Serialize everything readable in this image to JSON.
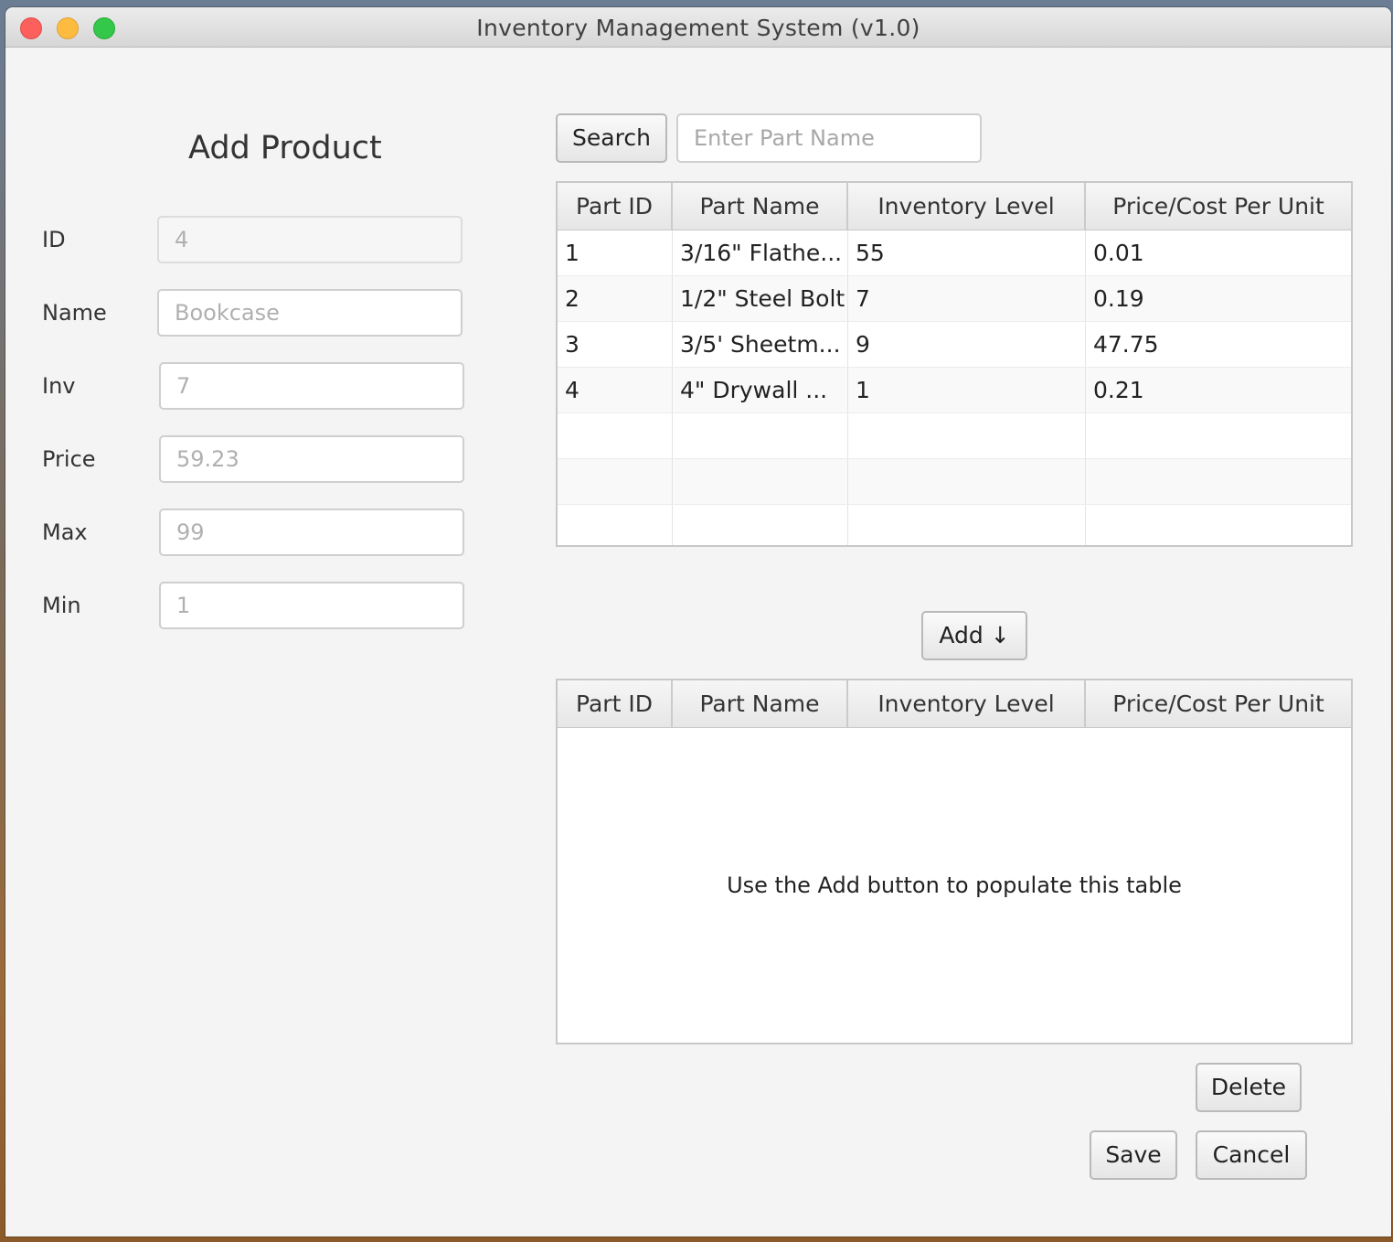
{
  "window": {
    "title": "Inventory Management System (v1.0)"
  },
  "form": {
    "heading": "Add Product",
    "fields": [
      {
        "label": "ID",
        "value": "4"
      },
      {
        "label": "Name",
        "value": "Bookcase"
      },
      {
        "label": "Inv",
        "value": "7"
      },
      {
        "label": "Price",
        "value": "59.23"
      },
      {
        "label": "Max",
        "value": "99"
      },
      {
        "label": "Min",
        "value": "1"
      }
    ]
  },
  "search": {
    "button_label": "Search",
    "placeholder": "Enter Part Name"
  },
  "parts_table": {
    "headers": [
      "Part ID",
      "Part Name",
      "Inventory Level",
      "Price/Cost Per Unit"
    ],
    "rows": [
      [
        "1",
        "3/16\" Flathe...",
        "55",
        "0.01"
      ],
      [
        "2",
        "1/2\" Steel Bolt",
        "7",
        "0.19"
      ],
      [
        "3",
        "3/5' Sheetm...",
        "9",
        "47.75"
      ],
      [
        "4",
        "4\" Drywall ...",
        "1",
        "0.21"
      ]
    ]
  },
  "add_button": {
    "label": "Add",
    "icon": "arrow-down-icon",
    "glyph": "↓"
  },
  "associated_table": {
    "headers": [
      "Part ID",
      "Part Name",
      "Inventory Level",
      "Price/Cost Per Unit"
    ],
    "placeholder": "Use the Add button to populate this table"
  },
  "actions": {
    "delete_label": "Delete",
    "save_label": "Save",
    "cancel_label": "Cancel"
  }
}
